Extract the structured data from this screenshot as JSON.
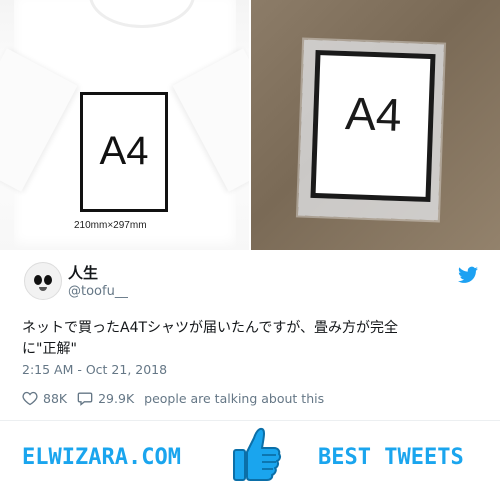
{
  "photos": {
    "left": {
      "label": "A4",
      "dimensions": "210mm×297mm"
    },
    "right": {
      "label": "A4"
    }
  },
  "tweet": {
    "name": "人生",
    "handle": "@toofu__",
    "text_line1": "ネットで買ったA4Tシャツが届いたんですが、畳み方が完全",
    "text_line2": "に\"正解\"",
    "timestamp": "2:15 AM - Oct 21, 2018",
    "likes": "88K",
    "replies": "29.9K",
    "talking": "people are talking about this"
  },
  "banner": {
    "left_text": "ELWIZARA.COM",
    "right_text": "BEST TWEETS",
    "accent": "#1aa5ee"
  },
  "icons": {
    "twitter": "twitter-bird-icon",
    "like": "heart-icon",
    "reply": "speech-bubble-icon",
    "thumb": "thumbs-up-icon"
  }
}
